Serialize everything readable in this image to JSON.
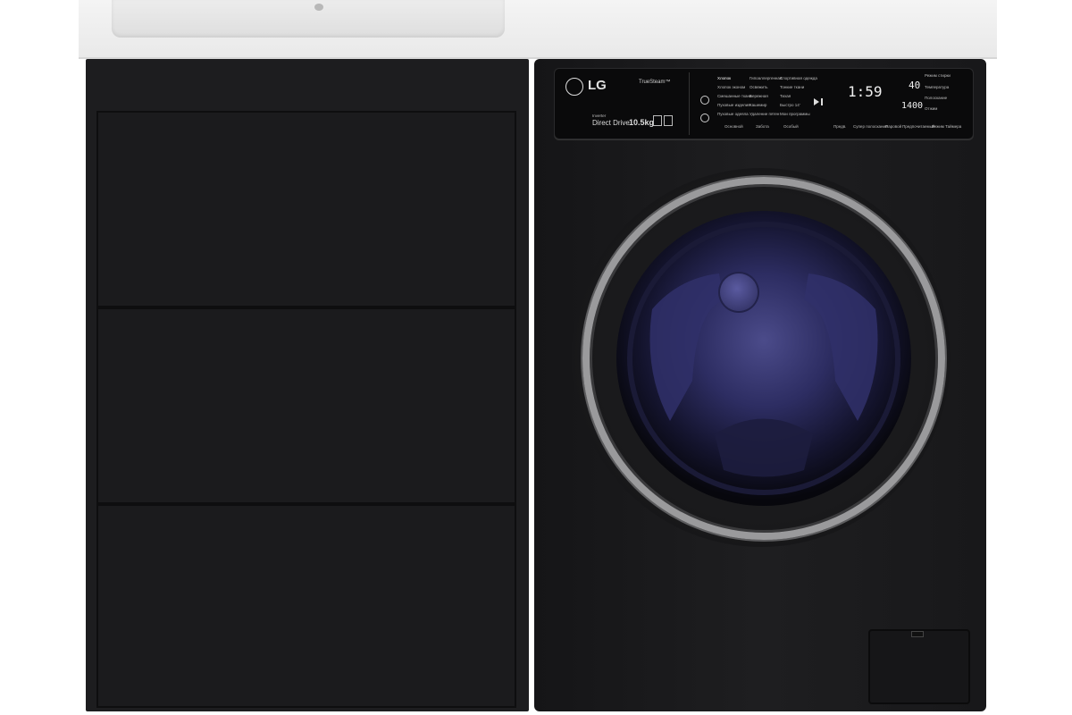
{
  "panel": {
    "brand": "LG",
    "feature": "TrueSteam™",
    "inverter": "Inverter",
    "direct_drive": "Direct Drive",
    "capacity": "10.5kg",
    "programs_col1": [
      "Хлопок",
      "Хлопок эконом",
      "Смешанные ткани",
      "Пуховые изделия",
      "Пуховые одеяла"
    ],
    "programs_col2": [
      "Гипоаллергенная",
      "Освежить",
      "Бережная",
      "Кашемир",
      "Удаление пятен"
    ],
    "programs_col3": [
      "Спортивная одежда",
      "Тонкие ткани",
      "Тихая",
      "Быстро 14'",
      "Мои программы"
    ],
    "groups": [
      "Основной",
      "Забота",
      "Особый"
    ],
    "display_time": "1:59",
    "display_temp": "40",
    "display_spin": "1400",
    "right_labels": [
      "Режим стирки",
      "Температура",
      "Полоскание",
      "Отжим"
    ],
    "bottom_buttons": [
      "Предв.",
      "Супер полоскание",
      "Паровой",
      "Предпочитаемый",
      "Режим Таймера"
    ]
  },
  "colors": {
    "body": "#1d1d1f",
    "countertop": "#eeeeee",
    "door_ring": "#9a9a9c",
    "drum_glow": "#3a3a7a"
  },
  "icons": [
    "power-icon",
    "play-pause-icon",
    "faucet-hole-icon"
  ]
}
